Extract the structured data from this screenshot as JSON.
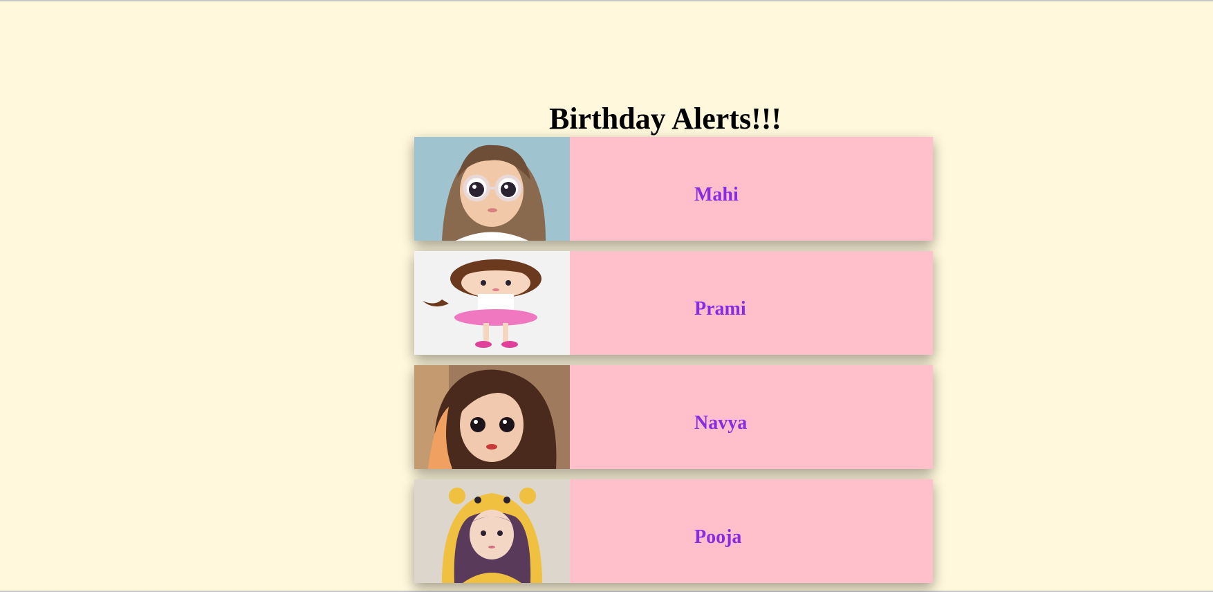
{
  "page": {
    "title": "Birthday Alerts!!!"
  },
  "colors": {
    "background": "#fff8dc",
    "card": "#ffc0cb",
    "name": "#8a2be2",
    "title": "#000000"
  },
  "people": [
    {
      "name": "Mahi",
      "avatar": "cartoon-girl-glasses-avatar"
    },
    {
      "name": "Prami",
      "avatar": "cartoon-girl-pink-skirt-avatar"
    },
    {
      "name": "Navya",
      "avatar": "cartoon-girl-long-hair-avatar"
    },
    {
      "name": "Pooja",
      "avatar": "cartoon-girl-bear-hoodie-avatar"
    }
  ]
}
